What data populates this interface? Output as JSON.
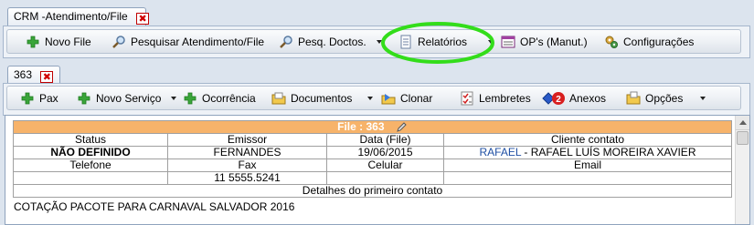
{
  "top_tab": {
    "label": "CRM -Atendimento/File"
  },
  "main_toolbar": {
    "items": [
      {
        "label": "Novo File",
        "icon": "plus-icon"
      },
      {
        "label": "Pesquisar Atendimento/File",
        "icon": "search-icon"
      },
      {
        "label": "Pesq. Doctos.",
        "icon": "search-icon"
      },
      {
        "label": "Relatórios",
        "icon": "report-icon"
      },
      {
        "label": "OP's (Manut.)",
        "icon": "window-icon"
      },
      {
        "label": "Configurações",
        "icon": "gears-icon"
      }
    ]
  },
  "file_tab": {
    "label": "363"
  },
  "file_toolbar": {
    "items": [
      {
        "label": "Pax",
        "icon": "plus-icon"
      },
      {
        "label": "Novo Serviço",
        "icon": "plus-icon"
      },
      {
        "label": "Ocorrência",
        "icon": "plus-icon"
      },
      {
        "label": "Documentos",
        "icon": "folder-icon"
      },
      {
        "label": "Clonar",
        "icon": "clone-icon"
      },
      {
        "label": "Lembretes",
        "icon": "checklist-icon"
      },
      {
        "label": "Anexos",
        "icon": "attachment-icon",
        "badge": "2"
      },
      {
        "label": "Opções",
        "icon": "options-icon"
      }
    ]
  },
  "file": {
    "title": "File : 363",
    "headers": [
      "Status",
      "Emissor",
      "Data (File)",
      "Cliente contato"
    ],
    "status": "NÃO DEFINIDO",
    "emissor": "FERNANDES",
    "data_file": "19/06/2015",
    "cliente_link": "RAFAEL",
    "cliente_rest": " - RAFAEL LUÍS MOREIRA XAVIER",
    "headers2": [
      "Telefone",
      "Fax",
      "Celular",
      "Email"
    ],
    "telefone": "",
    "fax": "11 5555.5241",
    "celular": "",
    "email": "",
    "details_header": "Detalhes do primeiro contato",
    "details": "COTAÇÃO PACOTE PARA CARNAVAL SALVADOR 2016"
  },
  "colors": {
    "file_title_bg": "#f7b36a",
    "highlight_ellipse": "#33dd1a",
    "link": "#1f4fa3",
    "badge": "#d81f1f"
  }
}
